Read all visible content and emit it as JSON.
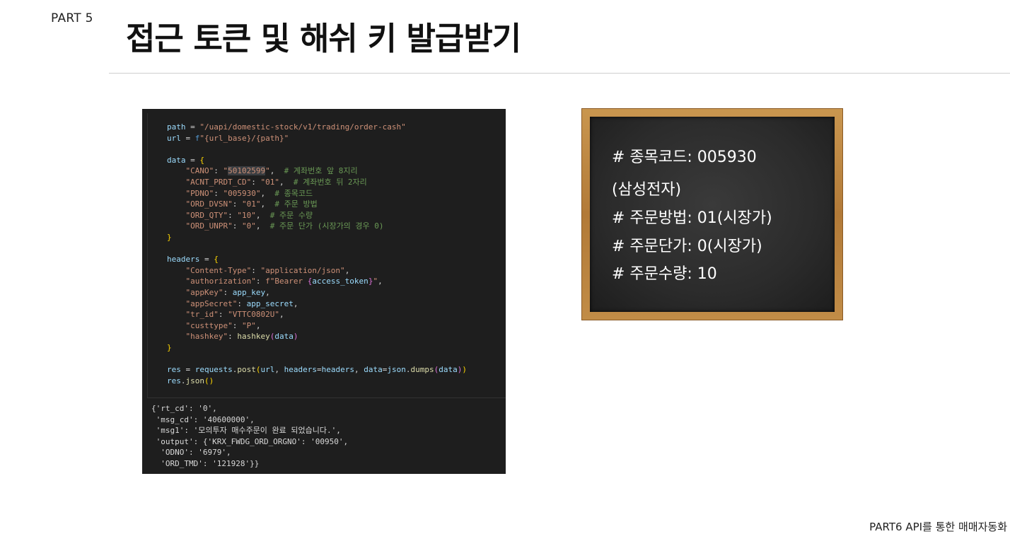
{
  "header": {
    "part_label": "PART 5",
    "title": "접근 토큰 및 해쉬 키 발급받기"
  },
  "code": {
    "lines": {
      "l1_var": "path",
      "l1_str": "\"/uapi/domestic-stock/v1/trading/order-cash\"",
      "l2_var": "url",
      "l2_f": "f",
      "l2_str": "\"{url_base}/{path}\"",
      "l4_var": "data",
      "l5_key": "\"CANO\"",
      "l5_val_pre": "\"",
      "l5_val_sel": "50102599",
      "l5_val_post": "\"",
      "l5_com": "# 계좌번호 앞 8지리",
      "l6_key": "\"ACNT_PRDT_CD\"",
      "l6_val": "\"01\"",
      "l6_com": "# 계좌번호 뒤 2자리",
      "l7_key": "\"PDNO\"",
      "l7_val": "\"005930\"",
      "l7_com": "# 종목코드",
      "l8_key": "\"ORD_DVSN\"",
      "l8_val": "\"01\"",
      "l8_com": "# 주문 방법",
      "l9_key": "\"ORD_QTY\"",
      "l9_val": "\"10\"",
      "l9_com": "# 주문 수량",
      "l10_key": "\"ORD_UNPR\"",
      "l10_val": "\"0\"",
      "l10_com": "# 주문 단가 (시장가의 경우 0)",
      "l13_var": "headers",
      "l14_key": "\"Content-Type\"",
      "l14_val": "\"application/json\"",
      "l15_key": "\"authorization\"",
      "l15_val_pre": "f\"Bearer ",
      "l15_val_var": "access_token",
      "l15_val_post": "\"",
      "l16_key": "\"appKey\"",
      "l16_val": "app_key",
      "l17_key": "\"appSecret\"",
      "l17_val": "app_secret",
      "l18_key": "\"tr_id\"",
      "l18_val": "\"VTTC0802U\"",
      "l19_key": "\"custtype\"",
      "l19_val": "\"P\"",
      "l20_key": "\"hashkey\"",
      "l20_fn": "hashkey",
      "l20_arg": "data",
      "l23_var": "res",
      "l23_mod": "requests",
      "l23_fn": "post",
      "l23_a1": "url",
      "l23_k1": "headers",
      "l23_v1": "headers",
      "l23_k2": "data",
      "l23_mod2": "json",
      "l23_fn2": "dumps",
      "l23_a2": "data",
      "l24_var": "res",
      "l24_fn": "json"
    },
    "output": [
      "{'rt_cd': '0',",
      " 'msg_cd': '40600000',",
      " 'msg1': '모의투자 매수주문이 완료 되었습니다.',",
      " 'output': {'KRX_FWDG_ORD_ORGNO': '00950',",
      "  'ODNO': '6979',",
      "  'ORD_TMD': '121928'}}"
    ]
  },
  "board": {
    "lines": [
      "# 종목코드: 005930",
      "(삼성전자)",
      "# 주문방법: 01(시장가)",
      "# 주문단가: 0(시장가)",
      "# 주문수량: 10"
    ]
  },
  "footer": {
    "text": "PART6 API를 통한 매매자동화"
  }
}
